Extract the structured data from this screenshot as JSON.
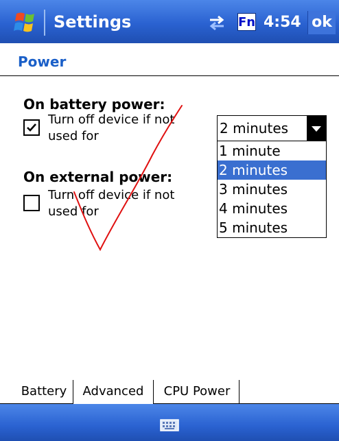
{
  "titlebar": {
    "app_title": "Settings",
    "fn_label": "Fn",
    "time": "4:54",
    "ok_label": "ok"
  },
  "page": {
    "title": "Power"
  },
  "battery_section": {
    "heading": "On battery power:",
    "checkbox_label": "Turn off device if not used for",
    "checked": true
  },
  "external_section": {
    "heading": "On external power:",
    "checkbox_label": "Turn off device if not used for",
    "checked": false
  },
  "timeout_dropdown": {
    "selected": "2 minutes",
    "options": [
      "1 minute",
      "2 minutes",
      "3 minutes",
      "4 minutes",
      "5 minutes"
    ]
  },
  "tabs": [
    {
      "label": "Battery",
      "active": false
    },
    {
      "label": "Advanced",
      "active": true
    },
    {
      "label": "CPU Power",
      "active": false
    }
  ],
  "colors": {
    "title_bar": "#2a62d1",
    "page_title": "#1a5fc8",
    "selection": "#3a6fd0",
    "annotation": "#e01010"
  },
  "icons": {
    "start": "windows-flag-icon",
    "connectivity": "connectivity-arrows-icon",
    "keyboard": "keyboard-icon"
  }
}
